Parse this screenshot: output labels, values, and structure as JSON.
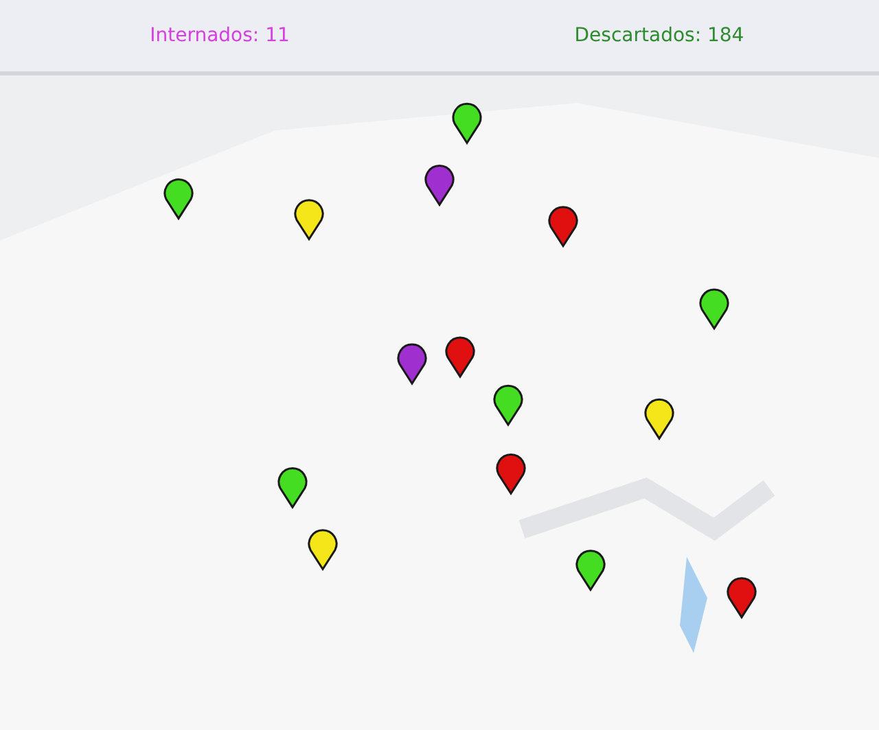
{
  "stats": [
    {
      "label": "Internados: 11",
      "color": "#d63fe0"
    },
    {
      "label": "Descartados: 184",
      "color": "#2e8b2e"
    }
  ]
}
